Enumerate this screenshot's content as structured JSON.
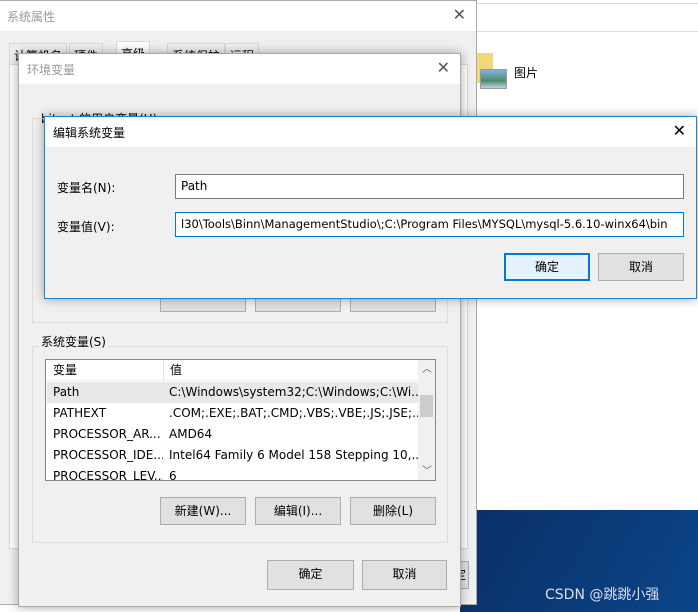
{
  "explorer": {
    "folder_label": "图片"
  },
  "watermark": "CSDN @跳跳小强",
  "sys_props": {
    "title": "系统属性",
    "tabs": [
      "计算机名",
      "硬件",
      "高级",
      "系统保护",
      "远程"
    ],
    "ok": "确定"
  },
  "env_vars": {
    "title": "环境变量",
    "user_group": "bitcat 的用户变量(U)",
    "sys_group": "系统变量(S)",
    "columns": [
      "变量",
      "值"
    ],
    "rows": [
      {
        "name": "Path",
        "value": "C:\\Windows\\system32;C:\\Windows;C:\\Wi..."
      },
      {
        "name": "PATHEXT",
        "value": ".COM;.EXE;.BAT;.CMD;.VBS;.VBE;.JS;.JSE;..."
      },
      {
        "name": "PROCESSOR_AR...",
        "value": "AMD64"
      },
      {
        "name": "PROCESSOR_IDE...",
        "value": "Intel64 Family 6 Model 158 Stepping 10,..."
      },
      {
        "name": "PROCESSOR_LEV...",
        "value": "6"
      }
    ],
    "new": "新建(W)...",
    "edit": "编辑(I)...",
    "delete": "删除(L)",
    "ok": "确定",
    "cancel": "取消"
  },
  "edit_dialog": {
    "title": "编辑系统变量",
    "name_label": "变量名(N):",
    "name_value": "Path",
    "value_label": "变量值(V):",
    "value_value": "l30\\Tools\\Binn\\ManagementStudio\\;C:\\Program Files\\MYSQL\\mysql-5.6.10-winx64\\bin",
    "ok": "确定",
    "cancel": "取消"
  },
  "colors": {
    "accent": "#0078d7",
    "desktop": "#0a3d7a"
  }
}
